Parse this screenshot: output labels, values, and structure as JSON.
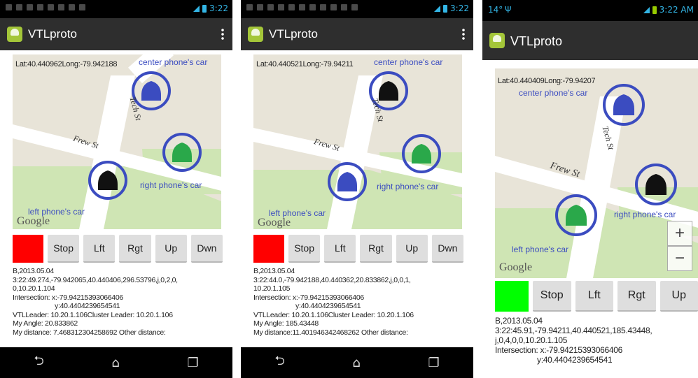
{
  "phones": [
    {
      "status_time": "3:22",
      "app_title": "VTLproto",
      "latlong": "Lat:40.440962Long:-79.942188",
      "labels": {
        "center": "center phone's car",
        "right": "right phone's car",
        "left": "left phone's car"
      },
      "streets": {
        "tech": "Tech St",
        "frew": "Frew St"
      },
      "google": "Google",
      "status_color": "#ff0000",
      "buttons": [
        "Stop",
        "Lft",
        "Rgt",
        "Up",
        "Dwn"
      ],
      "info": [
        "B,2013.05.04",
        "3:22:49.274,-79.942065,40.440406,296.53796,j,0,2,0,",
        "0,10.20.1.104",
        "Intersection: x:-79.94215393066406",
        "y:40.4404239654541",
        "VTLLeader: 10.20.1.106Cluster Leader: 10.20.1.106",
        "My Angle: 20.833862",
        "My distance: 7.468312304258692 Other distance:"
      ],
      "nav": [
        "back-icon",
        "home-icon",
        "recent-apps-icon"
      ]
    },
    {
      "status_time": "3:22",
      "app_title": "VTLproto",
      "latlong": "Lat:40.440521Long:-79.94211",
      "labels": {
        "center": "center phone's car",
        "right": "right phone's car",
        "left": "left phone's car"
      },
      "streets": {
        "tech": "Tech St",
        "frew": "Frew St"
      },
      "google": "Google",
      "status_color": "#ff0000",
      "buttons": [
        "Stop",
        "Lft",
        "Rgt",
        "Up",
        "Dwn"
      ],
      "info": [
        "B,2013.05.04",
        "3:22:44.0,-79.942188,40.440362,20.833862,j,0,0,1,",
        "10.20.1.105",
        "Intersection: x:-79.94215393066406",
        "y:40.4404239654541",
        "VTLLeader: 10.20.1.106Cluster Leader: 10.20.1.106",
        "My Angle: 185.43448",
        "My distance:11.401946342468262 Other distance:"
      ],
      "nav": [
        "back-icon",
        "home-icon",
        "recent-apps-icon"
      ]
    },
    {
      "status_time": "3:22 AM",
      "status_left": "14°",
      "app_title": "VTLproto",
      "latlong": "Lat:40.440409Long:-79.94207",
      "labels": {
        "center": "center phone's car",
        "right": "right phone's car",
        "left": "left phone's car"
      },
      "streets": {
        "tech": "Tech St",
        "frew": "Frew St"
      },
      "google": "Google",
      "zoom_in": "+",
      "zoom_out": "−",
      "status_color": "#00ff00",
      "buttons": [
        "Stop",
        "Lft",
        "Rgt",
        "Up"
      ],
      "info": [
        "B,2013.05.04",
        "3:22:45.91,-79.94211,40.440521,185.43448,",
        "j,0,4,0,0,10.20.1.105",
        "Intersection: x:-79.94215393066406",
        "y:40.4404239654541"
      ]
    }
  ],
  "colors": {
    "ring": "#3b4cc0",
    "car_blue": "#3b4cc0",
    "car_green": "#2aa84a",
    "car_black": "#111111",
    "road": "#ffffff",
    "park": "#cfe5b4",
    "land": "#e8e4d8",
    "map_label": "#3b4cc0"
  }
}
